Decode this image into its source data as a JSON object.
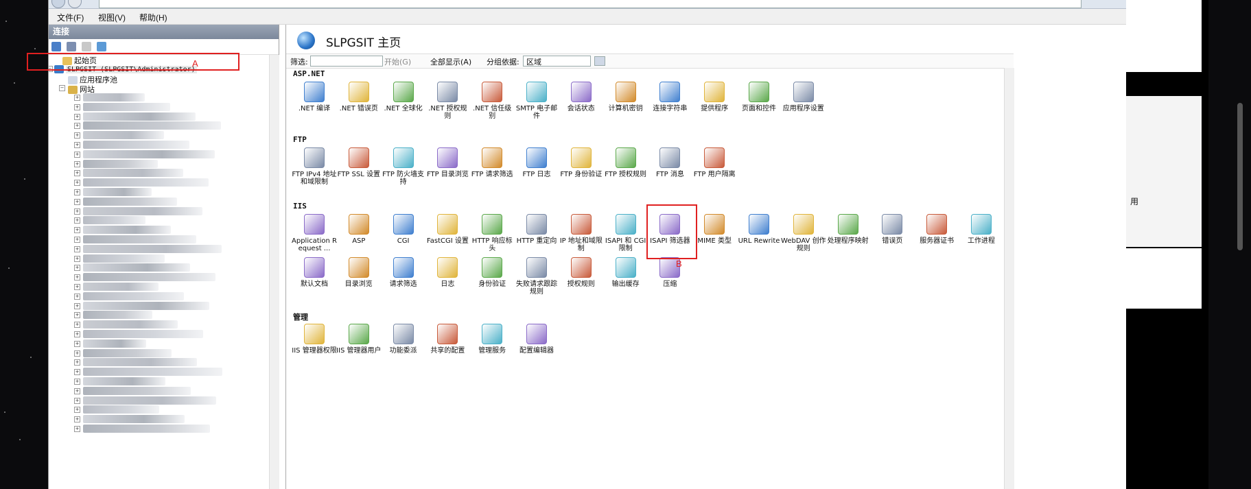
{
  "menu": [
    "文件(F)",
    "视图(V)",
    "帮助(H)"
  ],
  "left_pane": {
    "header": "连接",
    "tree": [
      {
        "label": "起始页",
        "level": 1
      },
      {
        "label": "SLPGSIT (SLPGSIT\\Administrator)",
        "level": 0
      },
      {
        "label": "应用程序池",
        "level": 2
      },
      {
        "label": "网站",
        "level": 2
      }
    ]
  },
  "page_title": "SLPGSIT 主页",
  "filter_bar": {
    "filter_label": "筛选:",
    "start_label": "开始(G)",
    "show_all_label": "全部显示(A)",
    "group_by_label": "分组依据:",
    "group_by_value": "区域"
  },
  "groups": [
    {
      "title": "ASP.NET",
      "items": [
        ".NET 编译",
        ".NET 错误页",
        ".NET 全球化",
        ".NET 授权规则",
        ".NET 信任级别",
        "SMTP 电子邮件",
        "会话状态",
        "计算机密钥",
        "连接字符串",
        "提供程序",
        "页面和控件",
        "应用程序设置"
      ]
    },
    {
      "title": "FTP",
      "items": [
        "FTP IPv4 地址和域限制",
        "FTP SSL 设置",
        "FTP 防火墙支持",
        "FTP 目录浏览",
        "FTP 请求筛选",
        "FTP 日志",
        "FTP 身份验证",
        "FTP 授权规则",
        "FTP 消息",
        "FTP 用户隔离"
      ]
    },
    {
      "title": "IIS",
      "items": [
        "Application Request ...",
        "ASP",
        "CGI",
        "FastCGI 设置",
        "HTTP 响应标头",
        "HTTP 重定向",
        "IP 地址和域限制",
        "ISAPI 和 CGI 限制",
        "ISAPI 筛选器",
        "MIME 类型",
        "URL Rewrite",
        "WebDAV 创作规则",
        "处理程序映射",
        "错误页",
        "服务器证书",
        "工作进程",
        "默认文档",
        "目录浏览",
        "请求筛选",
        "日志",
        "身份验证",
        "失败请求跟踪规则",
        "授权规则",
        "输出缓存",
        "压缩"
      ]
    },
    {
      "title": "管理",
      "items": [
        "IIS 管理器权限",
        "IIS 管理器用户",
        "功能委派",
        "共享的配置",
        "管理服务",
        "配置编辑器"
      ]
    }
  ],
  "annotations": {
    "a": "A",
    "b": "B"
  },
  "background_window": {
    "fragment": "用"
  }
}
